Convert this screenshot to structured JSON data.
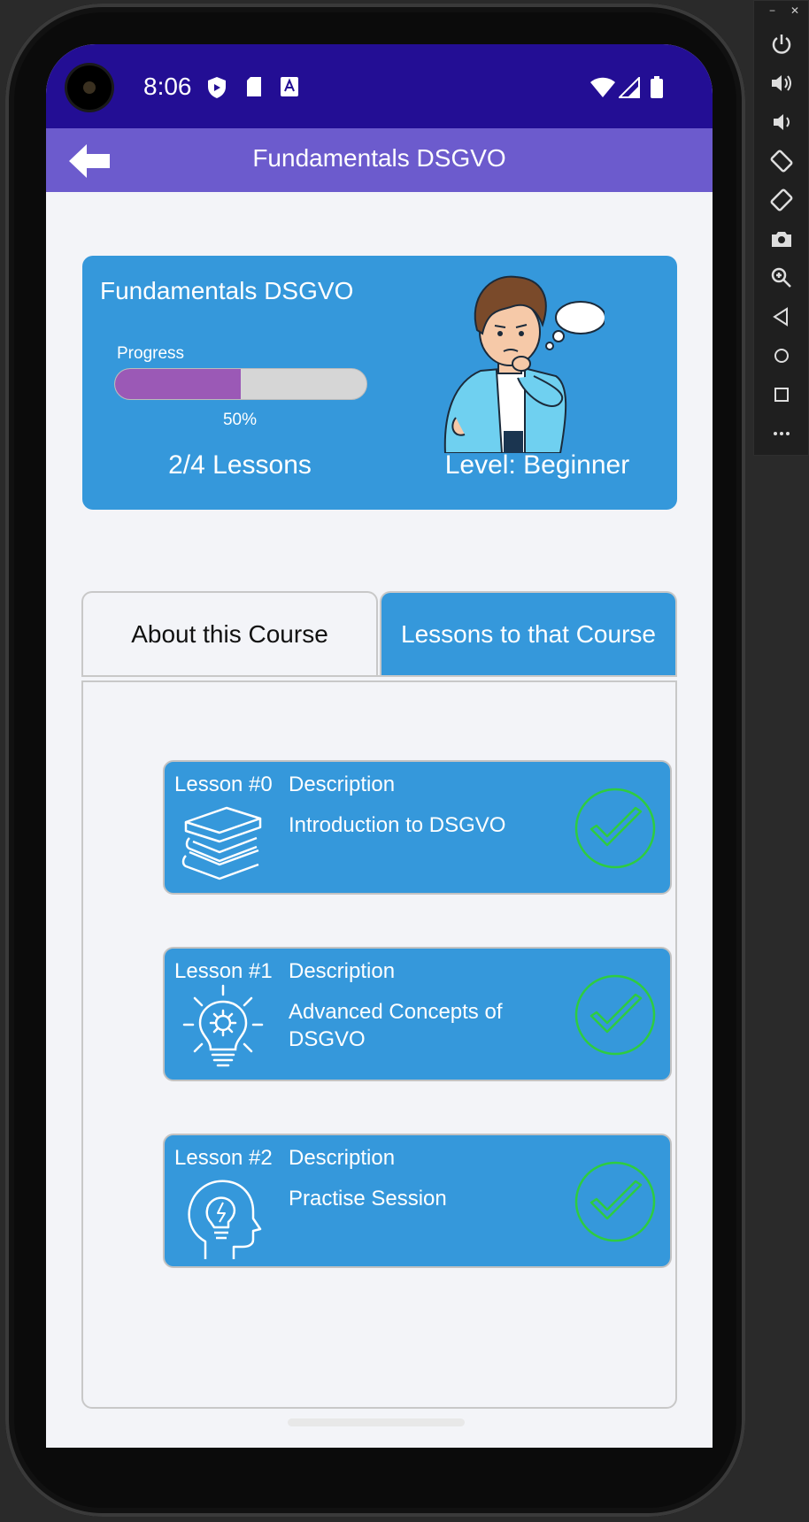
{
  "status_bar": {
    "time": "8:06",
    "icons": [
      "shield-icon",
      "sd-card-icon",
      "keyboard-a-icon",
      "wifi-icon",
      "signal-icon",
      "battery-icon"
    ]
  },
  "app_bar": {
    "title": "Fundamentals DSGVO",
    "back_icon": "arrow-left-icon"
  },
  "course": {
    "title": "Fundamentals DSGVO",
    "progress_label": "Progress",
    "progress_fraction": 0.5,
    "progress_text": "50%",
    "lessons_count": "2/4 Lessons",
    "level": "Level: Beginner",
    "illustration": "thinking-man-illustration"
  },
  "tabs": [
    {
      "label": "About this Course",
      "selected": false
    },
    {
      "label": "Lessons to that Course",
      "selected": true
    }
  ],
  "lessons": [
    {
      "number": "Lesson #0",
      "desc_label": "Description",
      "desc": "Introduction to DSGVO",
      "icon": "books-stack-icon",
      "status_icon": "check-circle-icon"
    },
    {
      "number": "Lesson #1",
      "desc_label": "Description",
      "desc": "Advanced Concepts of DSGVO",
      "icon": "lightbulb-gear-icon",
      "status_icon": "check-circle-icon"
    },
    {
      "number": "Lesson #2",
      "desc_label": "Description",
      "desc": "Practise Session",
      "icon": "head-lightbulb-icon",
      "status_icon": "check-circle-icon"
    }
  ],
  "colors": {
    "status_bar": "#230e94",
    "app_bar": "#6c5bcd",
    "card": "#3598db",
    "progress_fill": "#9b59b6",
    "check": "#2ecc40",
    "background": "#f3f4f8"
  },
  "emulator_toolbar": {
    "window_controls": [
      "−",
      "✕"
    ],
    "buttons": [
      "power-icon",
      "volume-up-icon",
      "volume-down-icon",
      "rotate-left-icon",
      "rotate-right-icon",
      "camera-icon",
      "zoom-icon",
      "back-triangle-icon",
      "home-circle-icon",
      "overview-square-icon",
      "more-icon"
    ]
  }
}
